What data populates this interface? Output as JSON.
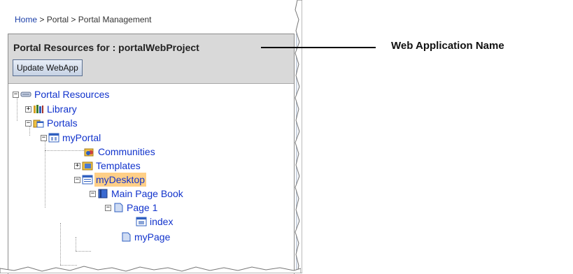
{
  "breadcrumb": {
    "home": "Home",
    "sep": ">",
    "portal": "Portal",
    "management": "Portal Management"
  },
  "panel": {
    "title": "Portal Resources for : portalWebProject",
    "update_button": "Update WebApp"
  },
  "tree": {
    "portal_resources": "Portal Resources",
    "library": "Library",
    "portals": "Portals",
    "myportal": "myPortal",
    "communities": "Communities",
    "templates": "Templates",
    "mydesktop": "myDesktop",
    "main_page_book": "Main Page Book",
    "page1": "Page 1",
    "index": "index",
    "mypage": "myPage"
  },
  "callout": {
    "label": "Web Application Name"
  },
  "colors": {
    "link": "#1133cc",
    "selected_bg": "#ffcf87",
    "header_bg": "#d9d9d9"
  },
  "icons": [
    "resources-icon",
    "library-icon",
    "portals-icon",
    "portal-icon",
    "communities-icon",
    "templates-icon",
    "desktop-icon",
    "book-icon",
    "page-icon",
    "portlet-icon"
  ]
}
